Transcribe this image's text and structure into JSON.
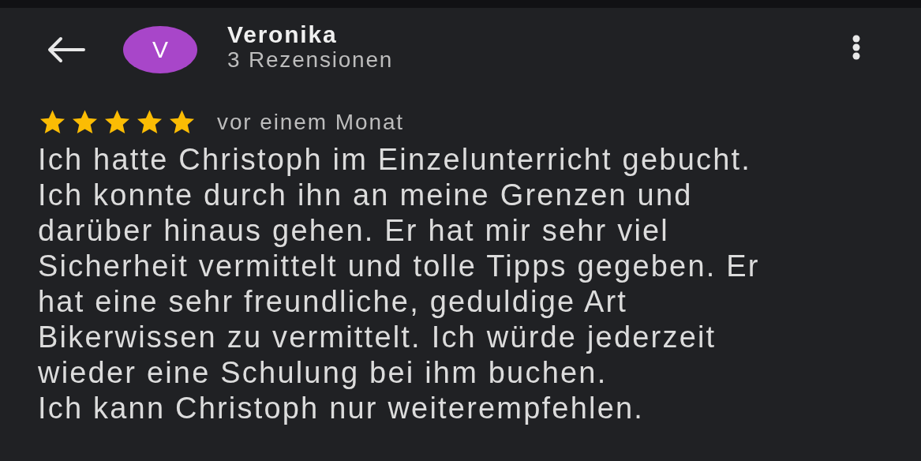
{
  "header": {
    "avatar_letter": "V",
    "name": "Veronika",
    "subtitle": "3 Rezensionen"
  },
  "review": {
    "stars": 5,
    "time": "vor einem Monat",
    "text": "Ich hatte Christoph im Einzelunterricht gebucht.\nIch konnte durch ihn an meine Grenzen und\ndarüber hinaus gehen. Er hat mir sehr viel\nSicherheit vermittelt und tolle Tipps gegeben. Er\nhat eine sehr freundliche, geduldige Art\nBikerwissen zu vermittelt. Ich würde jederzeit\nwieder eine Schulung bei ihm buchen.\nIch kann Christoph nur weiterempfehlen."
  }
}
